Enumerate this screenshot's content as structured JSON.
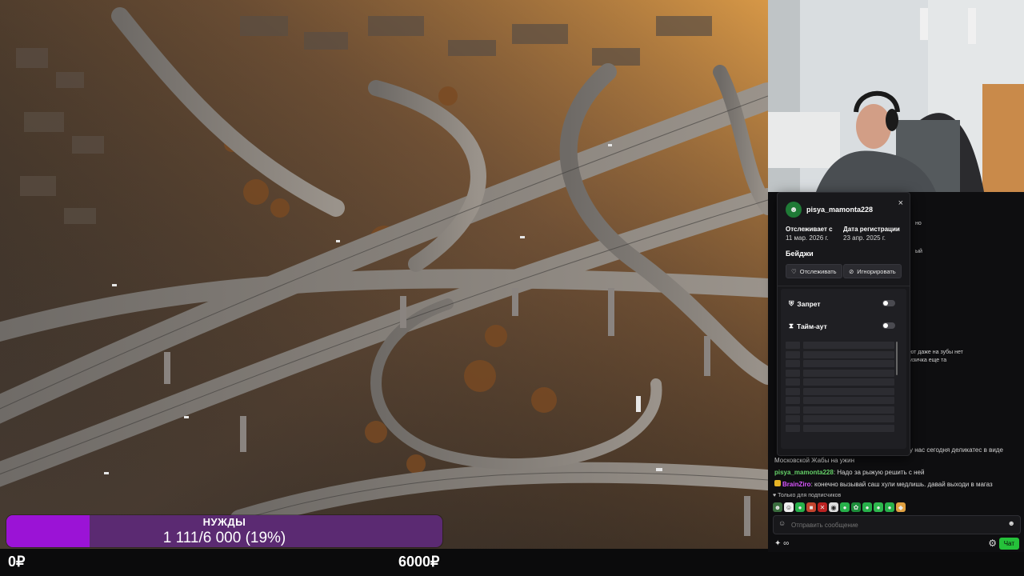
{
  "goal": {
    "title": "НУЖДЫ",
    "value_text": "1 111/6 000 (19%)",
    "progress_fraction": 0.19,
    "min_label": "0₽",
    "max_label": "6000₽",
    "bar_color": "#9b13d6",
    "track_color": "#5b2a72"
  },
  "user_card": {
    "username": "pisya_mamonta228",
    "close_icon": "×",
    "following_since_label": "Отслеживает с",
    "following_since_value": "11 мар. 2026 г.",
    "registered_label": "Дата регистрации",
    "registered_value": "23 апр. 2025 г.",
    "badges_label": "Бейджи",
    "follow_button": "Отслеживать",
    "ignore_button": "Игнорировать",
    "ban_label": "Запрет",
    "timeout_label": "Тайм-аут"
  },
  "chat": {
    "fragments": [
      "но",
      "ый",
      "ют даже на зубы нет",
      "изичка еще та",
      "у нас сегодня деликатес в виде"
    ],
    "messages": [
      {
        "user": "",
        "text": "Московской Жабы на ужин"
      },
      {
        "user": "pisya_mamonta228",
        "text": ": Надо за рыжую решить с ней"
      },
      {
        "user": "BrainZiro",
        "text": ": конечно вызывай саш хули медлишь. давай выходи в магаз"
      }
    ],
    "subs_only_label": "Только для подписчиков",
    "input_placeholder": "Отправить сообщение",
    "points_label": "∞",
    "send_button": "Чат"
  },
  "colors": {
    "accent_green": "#25c13a",
    "username_green": "#67d36a",
    "username_purple": "#d955ff"
  },
  "icons": {
    "close": "close-icon",
    "heart": "heart-icon",
    "ignore": "ignore-icon",
    "ban": "shield-icon",
    "timeout": "hourglass-icon",
    "settings": "gear-icon",
    "emote": "smile-icon"
  }
}
